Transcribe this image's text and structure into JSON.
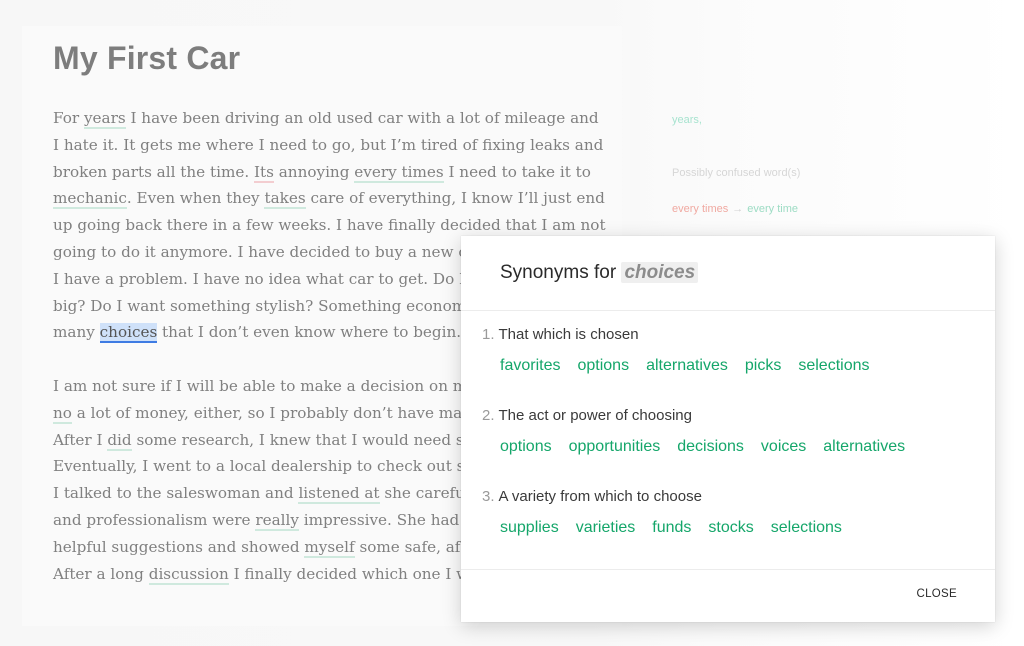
{
  "document": {
    "title": "My First Car",
    "p1": {
      "s1": "For ",
      "w1": "years",
      "s2": " I have been driving an old used car with a lot of mileage and",
      "s3": "I hate it. It gets me where I need to go, but I’m tired of fixing leaks and",
      "s4": "broken parts all the time. ",
      "w2": "Its",
      "s5": " annoying ",
      "w3": "every times",
      "s6": " I need to take it to",
      "w4": "mechanic",
      "s7": ". Even when they ",
      "w5": "takes",
      "s8": " care of everything, I know I’ll just end",
      "s9": "up going back there in a few weeks. I have finally decided that I am not",
      "s10": "going to do it anymore. I have decided to buy a new c",
      "s11": "I have a problem. I have no idea what car to get. Do I",
      "s12": "big? Do I want something stylish? Something econom",
      "s13": "many ",
      "w6": "choices",
      "s14": " that I don’t even know where to begin."
    },
    "p2": {
      "s1": "I am not sure if I will be able to make a decision on m",
      "w1": "no",
      "s2": " a lot of money, either, so I probably don’t have ma",
      "s3": "After I ",
      "w2": "did",
      "s4": " some research, I knew that I would need s",
      "s5": "Eventually, I went to a local dealership to check out s",
      "s6": "I talked to the saleswoman and ",
      "w3": "listened at",
      "s7": " she carefu",
      "s8": "and professionalism were ",
      "w4": "really",
      "s9": " impressive. She had",
      "s10": "helpful suggestions and showed ",
      "w5": "myself",
      "s11": " some safe, af",
      "s12": "After a long ",
      "w6": "discussion",
      "s13": " I finally decided which one I w"
    }
  },
  "sidebar": {
    "item1": "years,",
    "item2": "Possibly confused word(s)",
    "item3_wrong": "every times",
    "item3_arrow": "→",
    "item3_fix": "every time"
  },
  "popup": {
    "title_prefix": "Synonyms for ",
    "word": "choices",
    "senses": [
      {
        "number": "1.",
        "definition": "That which is chosen",
        "synonyms": [
          "favorites",
          "options",
          "alternatives",
          "picks",
          "selections"
        ]
      },
      {
        "number": "2.",
        "definition": "The act or power of choosing",
        "synonyms": [
          "options",
          "opportunities",
          "decisions",
          "voices",
          "alternatives"
        ]
      },
      {
        "number": "3.",
        "definition": "A variety from which to choose",
        "synonyms": [
          "supplies",
          "varieties",
          "funds",
          "stocks",
          "selections"
        ]
      }
    ],
    "close_label": "CLOSE"
  },
  "colors": {
    "synonym": "#15a66a",
    "selection_underline": "#3e7be3",
    "selection_background": "#cfe1f9"
  }
}
